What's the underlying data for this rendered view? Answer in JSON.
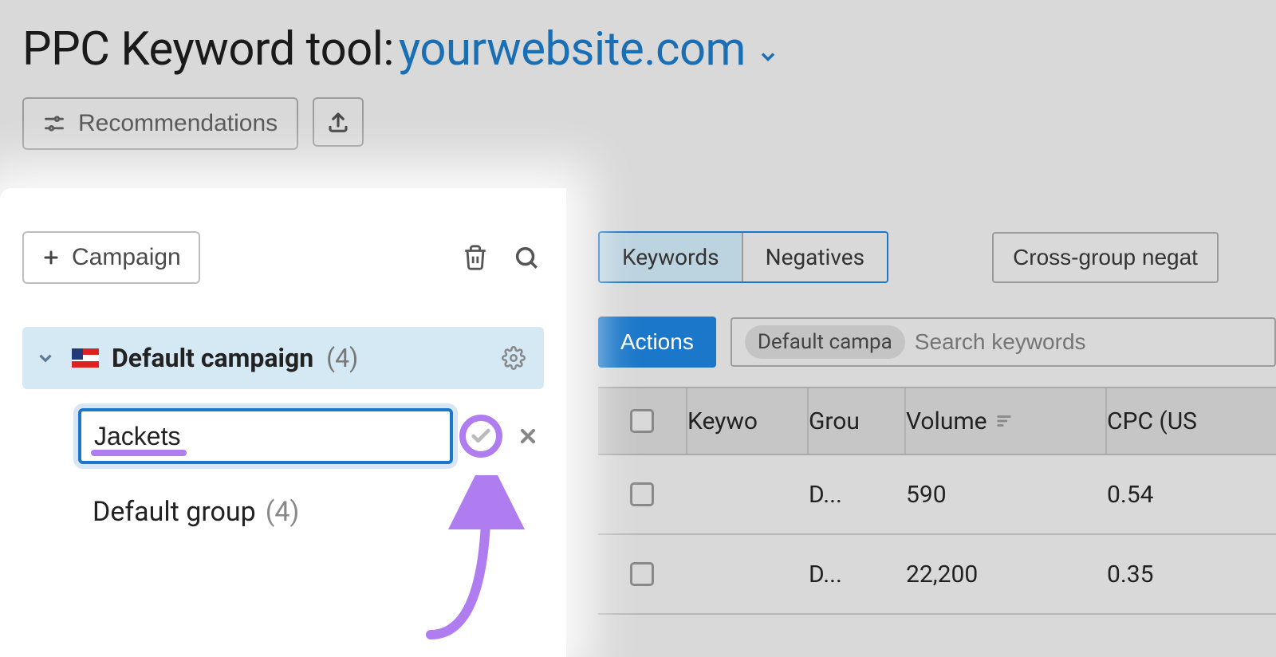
{
  "header": {
    "title_prefix": "PPC Keyword tool:",
    "domain": "yourwebsite.com",
    "recommendations_label": "Recommendations"
  },
  "sidebar": {
    "add_campaign_label": "Campaign",
    "campaign": {
      "name": "Default campaign",
      "count": "(4)"
    },
    "new_group_input_value": "Jackets",
    "group": {
      "name": "Default group",
      "count": "(4)"
    }
  },
  "right": {
    "tab_keywords": "Keywords",
    "tab_negatives": "Negatives",
    "cross_group_label": "Cross-group negat",
    "actions_label": "Actions",
    "filter_chip": "Default campa",
    "search_placeholder": "Search keywords",
    "columns": {
      "keyword": "Keywo",
      "group": "Grou",
      "volume": "Volume",
      "cpc": "CPC (US"
    },
    "rows": [
      {
        "group": "D...",
        "volume": "590",
        "cpc": "0.54"
      },
      {
        "group": "D...",
        "volume": "22,200",
        "cpc": "0.35"
      }
    ]
  }
}
